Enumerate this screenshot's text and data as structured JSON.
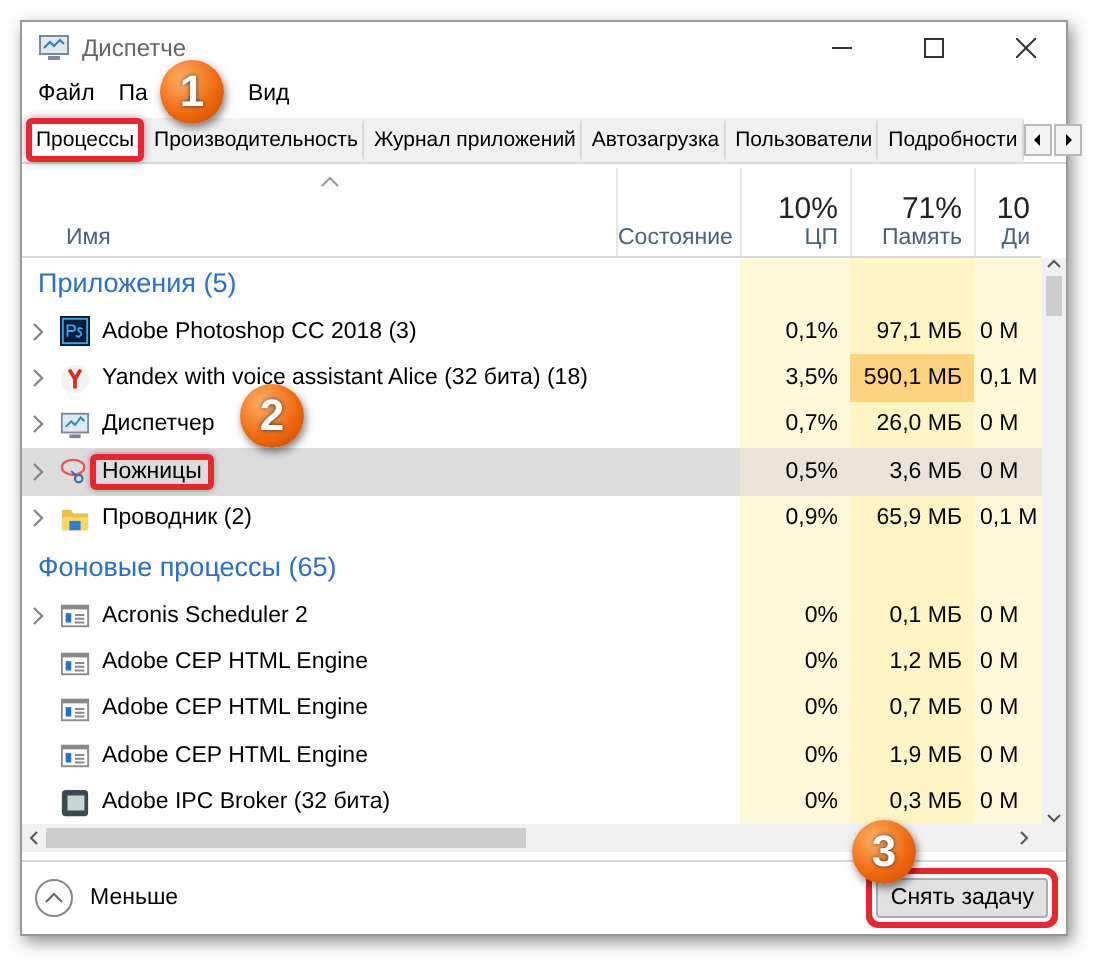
{
  "window": {
    "title": "Диспетче"
  },
  "menu": [
    {
      "label": "Файл"
    },
    {
      "label": "Па"
    },
    {
      "label": "Вид"
    }
  ],
  "tabs": [
    {
      "label": "Процессы",
      "selected": true,
      "highlighted": true
    },
    {
      "label": "Производительность",
      "selected": false,
      "highlighted": false
    },
    {
      "label": "Журнал приложений",
      "selected": false,
      "highlighted": false
    },
    {
      "label": "Автозагрузка",
      "selected": false,
      "highlighted": false
    },
    {
      "label": "Пользователи",
      "selected": false,
      "highlighted": false
    },
    {
      "label": "Подробности",
      "selected": false,
      "highlighted": false
    }
  ],
  "columns": [
    {
      "label": "Имя"
    },
    {
      "label": "Состояние"
    },
    {
      "label": "ЦП",
      "total": "10%"
    },
    {
      "label": "Память",
      "total": "71%"
    },
    {
      "label": "Ди",
      "total": "10"
    }
  ],
  "groups": [
    {
      "title": "Приложения (5)",
      "rows": [
        {
          "name": "Adobe Photoshop CC 2018 (3)",
          "expandable": true,
          "selected": false,
          "highlighted": false,
          "cpu": "0,1%",
          "memory": "97,1 МБ",
          "memory_hot": false,
          "disk": "0 М"
        },
        {
          "name": "Yandex with voice assistant Alice (32 бита) (18)",
          "expandable": true,
          "selected": false,
          "highlighted": false,
          "cpu": "3,5%",
          "memory": "590,1 МБ",
          "memory_hot": true,
          "disk": "0,1 М"
        },
        {
          "name": "Диспетчер",
          "expandable": true,
          "selected": false,
          "highlighted": false,
          "cpu": "0,7%",
          "memory": "26,0 МБ",
          "memory_hot": false,
          "disk": "0 М"
        },
        {
          "name": "Ножницы",
          "expandable": true,
          "selected": true,
          "highlighted": true,
          "cpu": "0,5%",
          "memory": "3,6 МБ",
          "memory_hot": false,
          "disk": "0 М"
        },
        {
          "name": "Проводник (2)",
          "expandable": true,
          "selected": false,
          "highlighted": false,
          "cpu": "0,9%",
          "memory": "65,9 МБ",
          "memory_hot": false,
          "disk": "0,1 М"
        }
      ]
    },
    {
      "title": "Фоновые процессы (65)",
      "rows": [
        {
          "name": "Acronis Scheduler 2",
          "expandable": true,
          "selected": false,
          "highlighted": false,
          "cpu": "0%",
          "memory": "0,1 МБ",
          "memory_hot": false,
          "disk": "0 М"
        },
        {
          "name": "Adobe CEP HTML Engine",
          "expandable": false,
          "selected": false,
          "highlighted": false,
          "cpu": "0%",
          "memory": "1,2 МБ",
          "memory_hot": false,
          "disk": "0 М"
        },
        {
          "name": "Adobe CEP HTML Engine",
          "expandable": false,
          "selected": false,
          "highlighted": false,
          "cpu": "0%",
          "memory": "0,7 МБ",
          "memory_hot": false,
          "disk": "0 М"
        },
        {
          "name": "Adobe CEP HTML Engine",
          "expandable": false,
          "selected": false,
          "highlighted": false,
          "cpu": "0%",
          "memory": "1,9 МБ",
          "memory_hot": false,
          "disk": "0 М"
        },
        {
          "name": "Adobe IPC Broker (32 бита)",
          "expandable": false,
          "selected": false,
          "highlighted": false,
          "cpu": "0%",
          "memory": "0,3 МБ",
          "memory_hot": false,
          "disk": "0 М"
        }
      ]
    }
  ],
  "footer": {
    "toggle": "Меньше",
    "button": {
      "label": "Снять задачу",
      "highlighted": true
    }
  },
  "callouts": [
    {
      "number": "1"
    },
    {
      "number": "2"
    },
    {
      "number": "3"
    }
  ]
}
